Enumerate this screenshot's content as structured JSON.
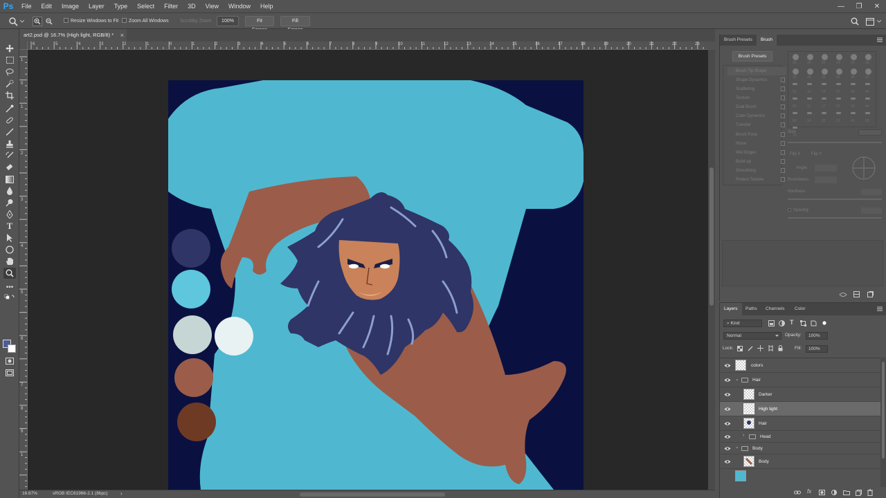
{
  "app": {
    "logo": "Ps"
  },
  "menu": [
    "File",
    "Edit",
    "Image",
    "Layer",
    "Type",
    "Select",
    "Filter",
    "3D",
    "View",
    "Window",
    "Help"
  ],
  "window_controls": {
    "minimize": "—",
    "restore": "❐",
    "close": "✕"
  },
  "options": {
    "resize_windows": "Resize Windows to Fit",
    "zoom_all": "Zoom All Windows",
    "scrubby": "Scrubby Zoom",
    "zoom_value": "100%",
    "fit_screen": "Fit Screen",
    "fill_screen": "Fill Screen"
  },
  "document": {
    "tab_title": "art2.psd @ 16.7% (High light, RGB/8) *",
    "close": "×"
  },
  "ruler_top": [
    "6",
    "5",
    "4",
    "3",
    "2",
    "1",
    "0",
    "1",
    "2",
    "3",
    "4",
    "5",
    "6",
    "7",
    "8",
    "9",
    "10",
    "11",
    "12",
    "13",
    "14",
    "15",
    "16",
    "17",
    "18",
    "19",
    "20",
    "21",
    "22",
    "23"
  ],
  "ruler_left": [
    "1",
    "0",
    "1",
    "2",
    "3",
    "4",
    "5",
    "6",
    "7",
    "8",
    "9",
    "1"
  ],
  "status": {
    "zoom": "16.67%",
    "profile": "sRGB IEC61966-2.1 (8bpc)",
    "arrow": "›"
  },
  "swatches": [
    "#2f3566",
    "#5ec6dd",
    "#c6d6d5",
    "#e8f2f2",
    "#9c5c4a",
    "#6f3a24"
  ],
  "brush_panel": {
    "tabs": [
      "Brush Presets",
      "Brush"
    ],
    "presets_button": "Brush Presets",
    "options": [
      "Brush Tip Shape",
      "Shape Dynamics",
      "Scattering",
      "Texture",
      "Dual Brush",
      "Color Dynamics",
      "Transfer",
      "Brush Pose",
      "Noise",
      "Wet Edges",
      "Build-up",
      "Smoothing",
      "Protect Texture"
    ],
    "tip_sizes": [
      "30",
      "30",
      "30",
      "25",
      "25",
      "25",
      "36",
      "25",
      "36",
      "36",
      "36",
      "32",
      "25",
      "14",
      "24",
      "27",
      "39",
      "46",
      "59",
      "11",
      "17",
      "23",
      "36",
      "44",
      "60",
      "14",
      "26",
      "33",
      "42",
      "55",
      "70"
    ],
    "size_label": "Size",
    "flip_x": "Flip X",
    "flip_y": "Flip Y",
    "angle": "Angle:",
    "roundness": "Roundness:",
    "hardness": "Hardness",
    "spacing": "Spacing"
  },
  "layers_panel": {
    "tabs": [
      "Layers",
      "Paths",
      "Channels",
      "Color"
    ],
    "filter_kind": "Kind",
    "blend_mode": "Normal",
    "opacity_label": "Opacity:",
    "opacity_value": "100%",
    "lock_label": "Lock:",
    "fill_label": "Fill:",
    "fill_value": "100%",
    "layers": [
      {
        "name": "colors",
        "type": "layer",
        "indent": 0,
        "selected": false
      },
      {
        "name": "Hair",
        "type": "group",
        "indent": 0,
        "selected": false
      },
      {
        "name": "Darker",
        "type": "layer",
        "indent": 1,
        "selected": false
      },
      {
        "name": "High light",
        "type": "layer",
        "indent": 1,
        "selected": true
      },
      {
        "name": "Hair",
        "type": "layer",
        "indent": 1,
        "selected": false
      },
      {
        "name": "Head",
        "type": "group",
        "indent": 1,
        "selected": false
      },
      {
        "name": "Body",
        "type": "group",
        "indent": 0,
        "selected": false
      },
      {
        "name": "Body",
        "type": "layer",
        "indent": 1,
        "selected": false
      }
    ]
  },
  "colors": {
    "artboard_bg": "#0a1141",
    "shirt": "#4fb8d0",
    "skin": "#9c5c4a",
    "hair": "#2f3566",
    "hair_highlight": "#8d9fd0",
    "face": "#c98259"
  }
}
